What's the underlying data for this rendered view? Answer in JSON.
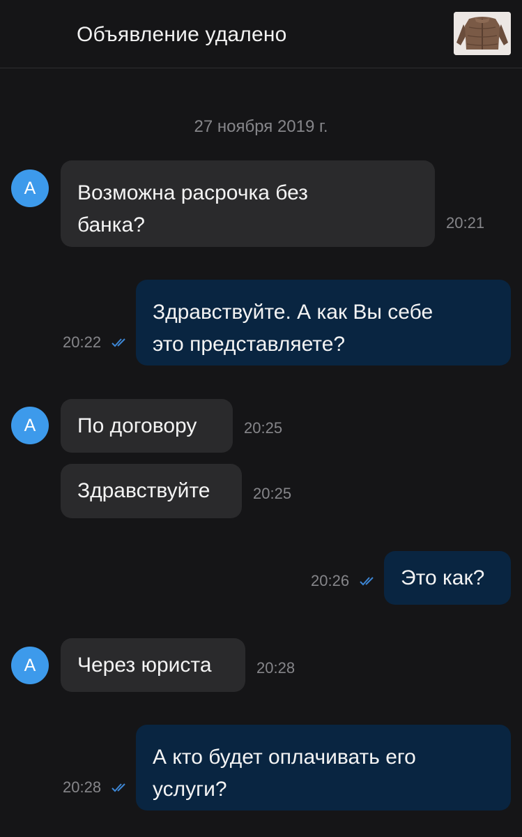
{
  "header": {
    "title": "Объявление удалено",
    "thumbnail_icon": "fur-coat-listing-photo"
  },
  "date_separator": "27 ноября 2019 г.",
  "contact": {
    "avatar_letter": "А",
    "avatar_color": "#3d9aeb"
  },
  "colors": {
    "background": "#151517",
    "incoming_bubble": "#2a2a2c",
    "outgoing_bubble": "#092541",
    "read_checks": "#3d86d4",
    "time_text": "#86868a"
  },
  "messages": [
    {
      "direction": "incoming",
      "lines": [
        "Возможна расрочка без",
        "банка?"
      ],
      "time": "20:21"
    },
    {
      "direction": "outgoing",
      "lines": [
        "Здравствуйте. А как Вы себе",
        "это представляете?"
      ],
      "time": "20:22",
      "status": "read"
    },
    {
      "direction": "incoming",
      "lines": [
        "По договору"
      ],
      "time": "20:25"
    },
    {
      "direction": "incoming",
      "lines": [
        "Здравствуйте"
      ],
      "time": "20:25"
    },
    {
      "direction": "outgoing",
      "lines": [
        "Это как?"
      ],
      "time": "20:26",
      "status": "read"
    },
    {
      "direction": "incoming",
      "lines": [
        "Через юриста"
      ],
      "time": "20:28"
    },
    {
      "direction": "outgoing",
      "lines": [
        "А кто будет оплачивать его",
        "услуги?"
      ],
      "time": "20:28",
      "status": "read"
    }
  ]
}
